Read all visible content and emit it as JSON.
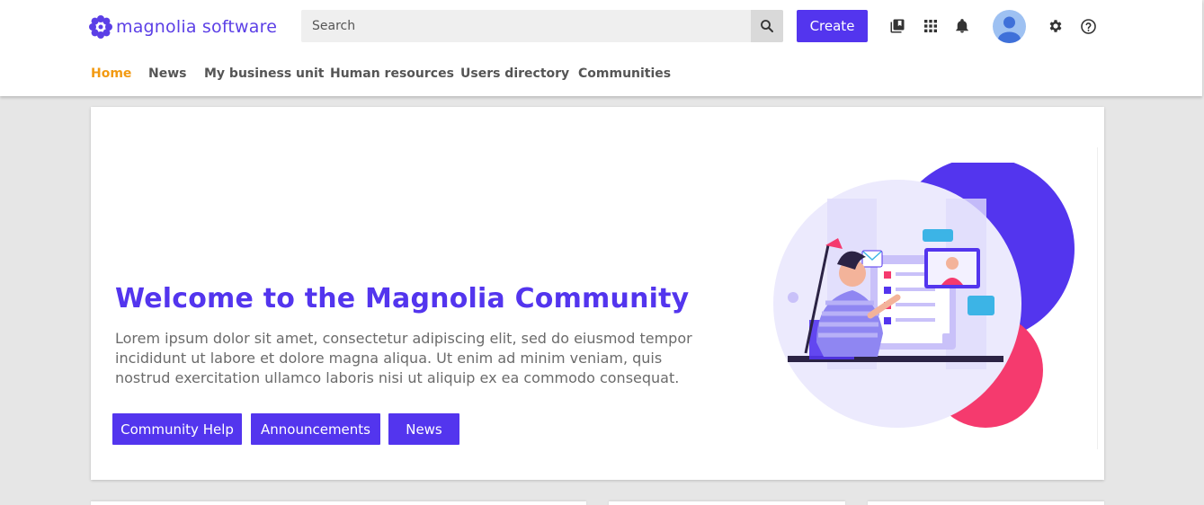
{
  "header": {
    "logo_text": "magnolia software",
    "search": {
      "placeholder": "Search"
    },
    "create_label": "Create",
    "icons": [
      "library-icon",
      "apps-grid-icon",
      "bell-icon",
      "avatar",
      "gear-icon",
      "help-icon"
    ]
  },
  "nav": {
    "items": [
      {
        "label": "Home",
        "active": true
      },
      {
        "label": "News"
      },
      {
        "label": "My business unit"
      },
      {
        "label": "Human resources"
      },
      {
        "label": "Users directory"
      },
      {
        "label": "Communities"
      }
    ]
  },
  "hero": {
    "title": "Welcome to the Magnolia Community",
    "text": "Lorem ipsum dolor sit amet, consectetur adipiscing elit, sed do eiusmod tempor incididunt ut labore et dolore magna aliqua. Ut enim ad minim veniam, quis nostrud exercitation ullamco laboris nisi ut aliquip ex ea commodo consequat.",
    "buttons": [
      {
        "label": "Community Help"
      },
      {
        "label": "Announcements"
      },
      {
        "label": "News"
      }
    ]
  },
  "colors": {
    "brand": "#5335ee",
    "nav_active": "#f29a12",
    "accent_pink": "#f53a6e",
    "background": "#e6e6e6"
  }
}
